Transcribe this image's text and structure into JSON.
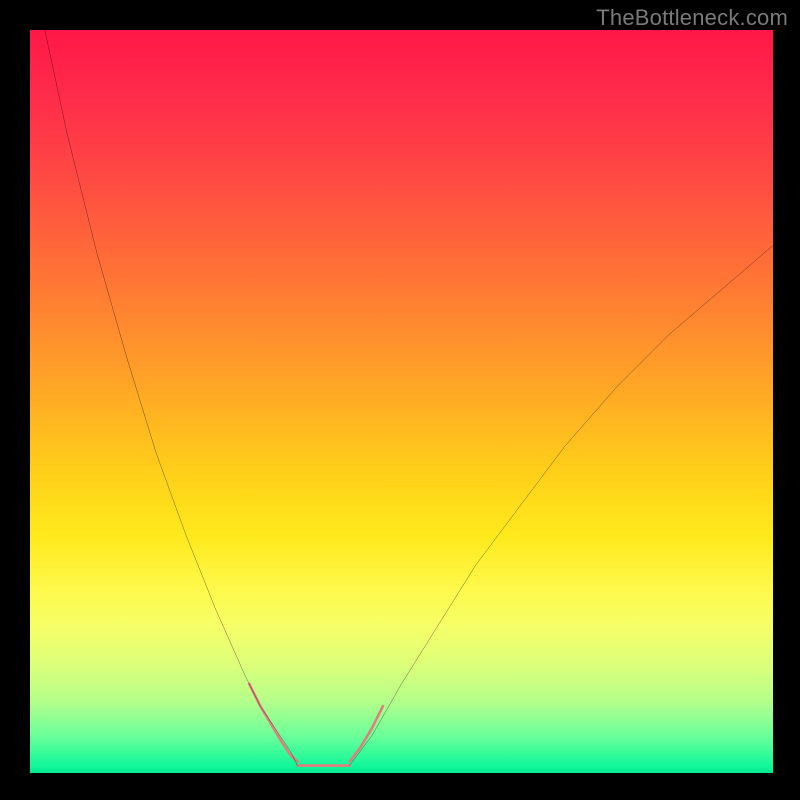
{
  "watermark": "TheBottleneck.com",
  "chart_data": {
    "type": "line",
    "title": "",
    "xlabel": "",
    "ylabel": "",
    "xlim": [
      0,
      100
    ],
    "ylim": [
      0,
      100
    ],
    "grid": false,
    "legend": false,
    "series": [
      {
        "name": "left-curve",
        "color": "#000000",
        "x": [
          2,
          5,
          9,
          13,
          17,
          21,
          25,
          29,
          31,
          33,
          35,
          36
        ],
        "y": [
          100,
          86,
          70,
          56,
          43,
          32,
          22,
          13,
          9,
          6,
          3,
          1
        ]
      },
      {
        "name": "right-curve",
        "color": "#000000",
        "x": [
          43,
          46,
          50,
          55,
          60,
          66,
          72,
          79,
          86,
          93,
          100
        ],
        "y": [
          1,
          5,
          12,
          20,
          28,
          36,
          44,
          52,
          59,
          65,
          71
        ]
      },
      {
        "name": "bottom-marker-left",
        "color": "#e27e7e",
        "style": "thick-round",
        "x": [
          29.5,
          31,
          32.5,
          34,
          35,
          36
        ],
        "y": [
          12,
          9,
          6.5,
          4,
          2.5,
          1.5
        ]
      },
      {
        "name": "bottom-marker-flat",
        "color": "#e27e7e",
        "style": "thick-round",
        "x": [
          36,
          38,
          40,
          42,
          43
        ],
        "y": [
          1,
          1,
          1,
          1,
          1
        ]
      },
      {
        "name": "bottom-marker-right",
        "color": "#e27e7e",
        "style": "thick-round",
        "x": [
          43,
          44.5,
          46,
          47.5
        ],
        "y": [
          1.5,
          3.5,
          6,
          9
        ]
      }
    ]
  }
}
